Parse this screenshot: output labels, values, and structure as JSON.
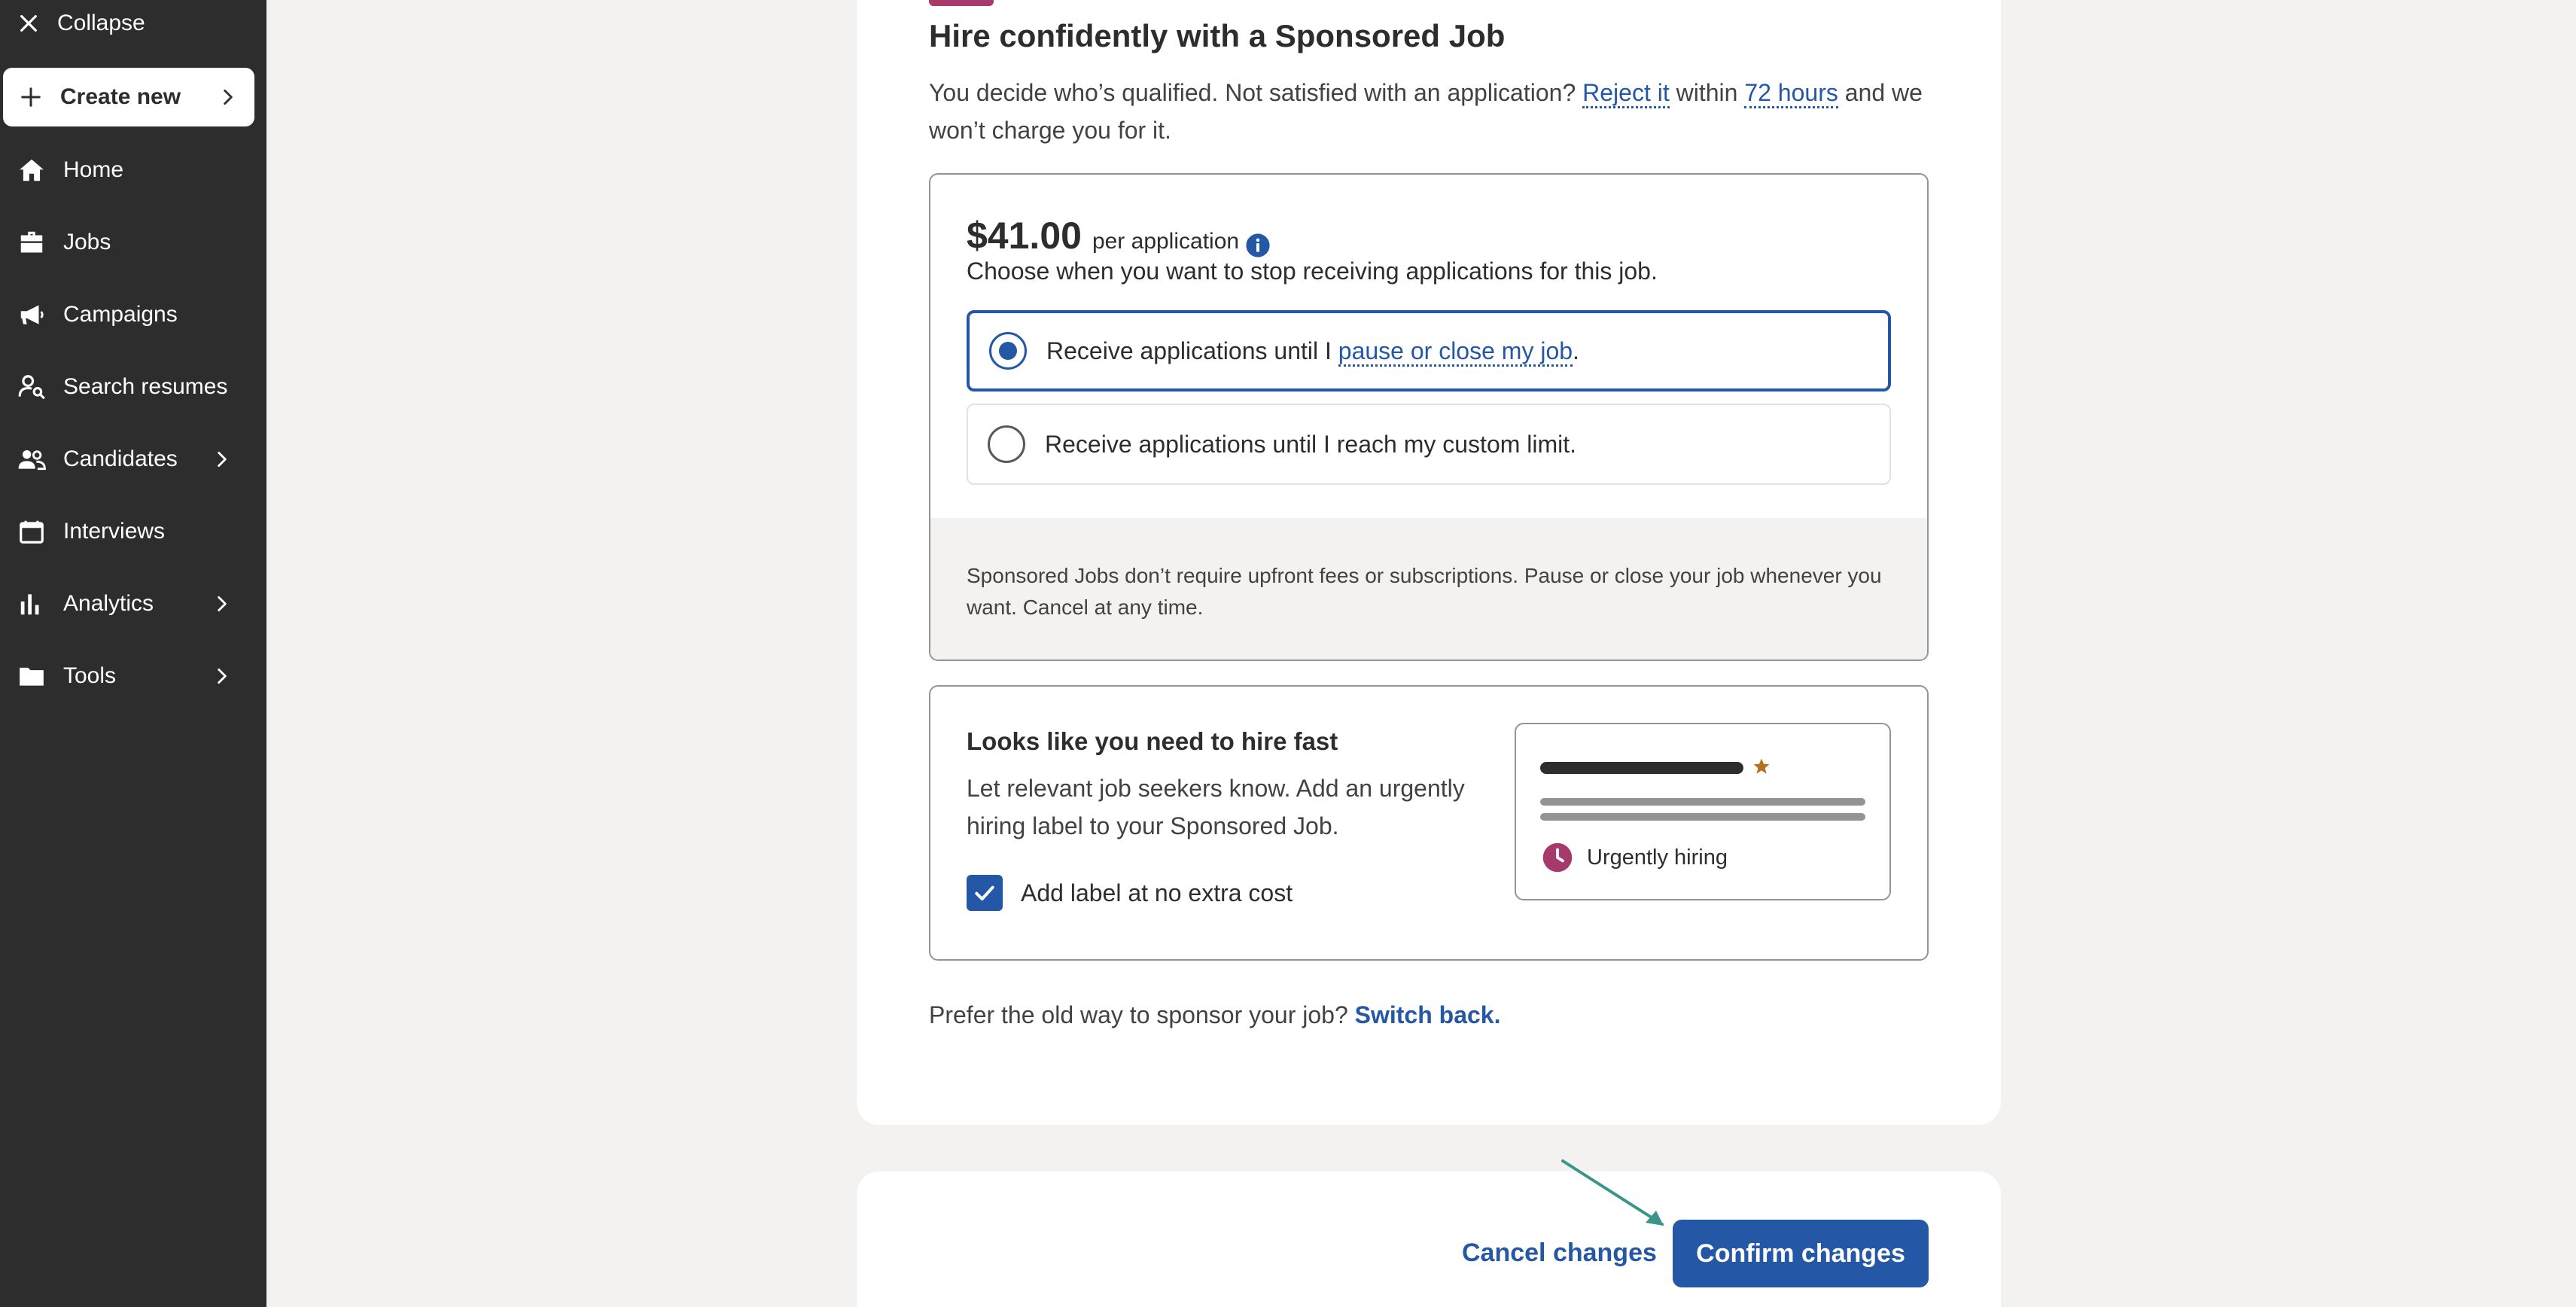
{
  "sidebar": {
    "collapse_label": "Collapse",
    "create_new_label": "Create new",
    "items": [
      {
        "label": "Home",
        "icon": "home-icon"
      },
      {
        "label": "Jobs",
        "icon": "briefcase-icon"
      },
      {
        "label": "Campaigns",
        "icon": "megaphone-icon"
      },
      {
        "label": "Search resumes",
        "icon": "person-search-icon"
      },
      {
        "label": "Candidates",
        "icon": "people-icon"
      },
      {
        "label": "Interviews",
        "icon": "calendar-icon"
      },
      {
        "label": "Analytics",
        "icon": "bar-chart-icon"
      },
      {
        "label": "Tools",
        "icon": "folder-icon"
      }
    ]
  },
  "main": {
    "heading": "Hire confidently with a Sponsored Job",
    "sub_part1": "You decide who’s qualified. Not satisfied with an application? ",
    "sub_link1": "Reject it",
    "sub_part2": " within ",
    "sub_link2": "72 hours",
    "sub_part3": " and we won’t charge you for it.",
    "pricing": {
      "price": "$41.00",
      "per": "per application",
      "choose": "Choose when you want to stop receiving applications for this job.",
      "option1_prefix": "Receive applications until I ",
      "option1_link": "pause or close my job",
      "option1_suffix": ".",
      "option2": "Receive applications until I reach my custom limit.",
      "note": "Sponsored Jobs don’t require upfront fees or subscriptions. Pause or close your job whenever you want. Cancel at any time."
    },
    "urgent": {
      "title": "Looks like you need to hire fast",
      "desc": "Let relevant job seekers know. Add an urgently hiring label to your Sponsored Job.",
      "checkbox_label": "Add label at no extra cost",
      "preview_badge": "Urgently hiring"
    },
    "switch_back_text": "Prefer the old way to sponsor your job? ",
    "switch_back_link": "Switch back."
  },
  "footer": {
    "cancel_label": "Cancel changes",
    "confirm_label": "Confirm changes"
  },
  "colors": {
    "sidebar_bg": "#2d2d2d",
    "accent": "#2557a7",
    "badge": "#a83a6b",
    "star": "#b8701e",
    "arrow": "#3a9688"
  }
}
